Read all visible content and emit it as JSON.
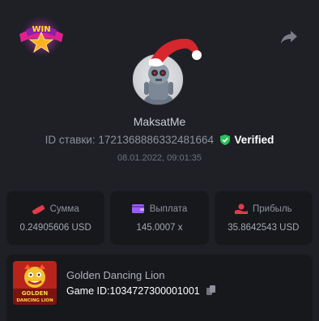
{
  "header": {
    "badge_text": "WIN",
    "share_icon": "share-icon"
  },
  "profile": {
    "username": "MaksatMe",
    "bet_id_label": "ID ставки:",
    "bet_id": "1721368886332481664",
    "verified_label": "Verified",
    "datetime": "08.01.2022, 09:01:35"
  },
  "stats": [
    {
      "label": "Сумма",
      "value": "0.24905606 USD",
      "icon": "wager-icon"
    },
    {
      "label": "Выплата",
      "value": "145.0007 x",
      "icon": "wallet-icon"
    },
    {
      "label": "Прибыль",
      "value": "35.8642543 USD",
      "icon": "profit-icon"
    }
  ],
  "game": {
    "title": "Golden Dancing Lion",
    "game_id_label": "Game ID:",
    "game_id": "1034727300001001",
    "thumb_text_line1": "GOLDEN",
    "thumb_text_line2": "DANCING LION"
  },
  "colors": {
    "background": "#1e2026",
    "card": "#17181c",
    "verified_green": "#29c25b",
    "accent_red": "#e23b4b",
    "accent_purple": "#9b5cf6"
  }
}
